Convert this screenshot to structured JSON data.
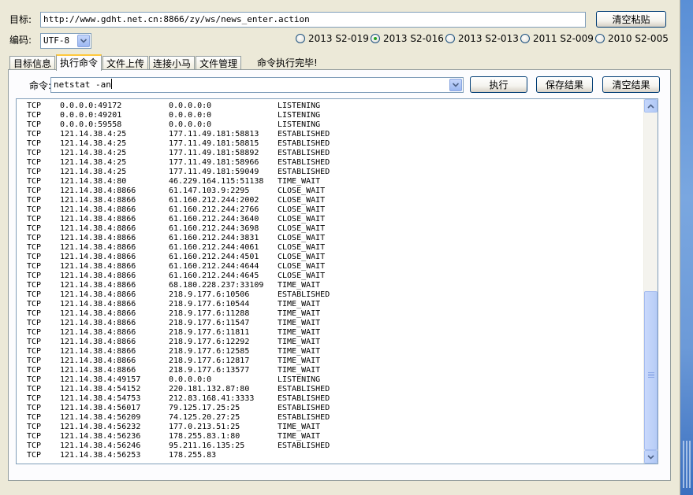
{
  "target": {
    "label": "目标:",
    "url": "http://www.gdht.net.cn:8866/zy/ws/news_enter.action",
    "clear_paste_label": "清空粘贴"
  },
  "encoding": {
    "label": "编码:",
    "selected": "UTF-8"
  },
  "versions": [
    {
      "label": "2013 S2-019",
      "checked": false
    },
    {
      "label": "2013 S2-016",
      "checked": true
    },
    {
      "label": "2013 S2-013",
      "checked": false
    },
    {
      "label": "2011 S2-009",
      "checked": false
    },
    {
      "label": "2010 S2-005",
      "checked": false
    }
  ],
  "tabs": [
    {
      "label": "目标信息",
      "active": false
    },
    {
      "label": "执行命令",
      "active": true
    },
    {
      "label": "文件上传",
      "active": false
    },
    {
      "label": "连接小马",
      "active": false
    },
    {
      "label": "文件管理",
      "active": false
    }
  ],
  "status": "命令执行完毕!",
  "command": {
    "label": "命令:",
    "value": "netstat -an",
    "execute_label": "执行",
    "save_label": "保存结果",
    "clear_label": "清空结果"
  },
  "scrollbar": {
    "position_fraction": 0.49,
    "visible_fraction": 0.47
  },
  "output_rows": [
    [
      "TCP",
      "0.0.0.0:49172",
      "0.0.0.0:0",
      "LISTENING"
    ],
    [
      "TCP",
      "0.0.0.0:49201",
      "0.0.0.0:0",
      "LISTENING"
    ],
    [
      "TCP",
      "0.0.0.0:59558",
      "0.0.0.0:0",
      "LISTENING"
    ],
    [
      "TCP",
      "121.14.38.4:25",
      "177.11.49.181:58813",
      "ESTABLISHED"
    ],
    [
      "TCP",
      "121.14.38.4:25",
      "177.11.49.181:58815",
      "ESTABLISHED"
    ],
    [
      "TCP",
      "121.14.38.4:25",
      "177.11.49.181:58892",
      "ESTABLISHED"
    ],
    [
      "TCP",
      "121.14.38.4:25",
      "177.11.49.181:58966",
      "ESTABLISHED"
    ],
    [
      "TCP",
      "121.14.38.4:25",
      "177.11.49.181:59049",
      "ESTABLISHED"
    ],
    [
      "TCP",
      "121.14.38.4:80",
      "46.229.164.115:51138",
      "TIME_WAIT"
    ],
    [
      "TCP",
      "121.14.38.4:8866",
      "61.147.103.9:2295",
      "CLOSE_WAIT"
    ],
    [
      "TCP",
      "121.14.38.4:8866",
      "61.160.212.244:2002",
      "CLOSE_WAIT"
    ],
    [
      "TCP",
      "121.14.38.4:8866",
      "61.160.212.244:2766",
      "CLOSE_WAIT"
    ],
    [
      "TCP",
      "121.14.38.4:8866",
      "61.160.212.244:3640",
      "CLOSE_WAIT"
    ],
    [
      "TCP",
      "121.14.38.4:8866",
      "61.160.212.244:3698",
      "CLOSE_WAIT"
    ],
    [
      "TCP",
      "121.14.38.4:8866",
      "61.160.212.244:3831",
      "CLOSE_WAIT"
    ],
    [
      "TCP",
      "121.14.38.4:8866",
      "61.160.212.244:4061",
      "CLOSE_WAIT"
    ],
    [
      "TCP",
      "121.14.38.4:8866",
      "61.160.212.244:4501",
      "CLOSE_WAIT"
    ],
    [
      "TCP",
      "121.14.38.4:8866",
      "61.160.212.244:4644",
      "CLOSE_WAIT"
    ],
    [
      "TCP",
      "121.14.38.4:8866",
      "61.160.212.244:4645",
      "CLOSE_WAIT"
    ],
    [
      "TCP",
      "121.14.38.4:8866",
      "68.180.228.237:33109",
      "TIME_WAIT"
    ],
    [
      "TCP",
      "121.14.38.4:8866",
      "218.9.177.6:10506",
      "ESTABLISHED"
    ],
    [
      "TCP",
      "121.14.38.4:8866",
      "218.9.177.6:10544",
      "TIME_WAIT"
    ],
    [
      "TCP",
      "121.14.38.4:8866",
      "218.9.177.6:11288",
      "TIME_WAIT"
    ],
    [
      "TCP",
      "121.14.38.4:8866",
      "218.9.177.6:11547",
      "TIME_WAIT"
    ],
    [
      "TCP",
      "121.14.38.4:8866",
      "218.9.177.6:11811",
      "TIME_WAIT"
    ],
    [
      "TCP",
      "121.14.38.4:8866",
      "218.9.177.6:12292",
      "TIME_WAIT"
    ],
    [
      "TCP",
      "121.14.38.4:8866",
      "218.9.177.6:12585",
      "TIME_WAIT"
    ],
    [
      "TCP",
      "121.14.38.4:8866",
      "218.9.177.6:12817",
      "TIME_WAIT"
    ],
    [
      "TCP",
      "121.14.38.4:8866",
      "218.9.177.6:13577",
      "TIME_WAIT"
    ],
    [
      "TCP",
      "121.14.38.4:49157",
      "0.0.0.0:0",
      "LISTENING"
    ],
    [
      "TCP",
      "121.14.38.4:54152",
      "220.181.132.87:80",
      "ESTABLISHED"
    ],
    [
      "TCP",
      "121.14.38.4:54753",
      "212.83.168.41:3333",
      "ESTABLISHED"
    ],
    [
      "TCP",
      "121.14.38.4:56017",
      "79.125.17.25:25",
      "ESTABLISHED"
    ],
    [
      "TCP",
      "121.14.38.4:56209",
      "74.125.20.27:25",
      "ESTABLISHED"
    ],
    [
      "TCP",
      "121.14.38.4:56232",
      "177.0.213.51:25",
      "TIME_WAIT"
    ],
    [
      "TCP",
      "121.14.38.4:56236",
      "178.255.83.1:80",
      "TIME_WAIT"
    ],
    [
      "TCP",
      "121.14.38.4:56246",
      "95.211.16.135:25",
      "ESTABLISHED"
    ],
    [
      "TCP",
      "121.14.38.4:56253",
      "178.255.83",
      ""
    ]
  ]
}
